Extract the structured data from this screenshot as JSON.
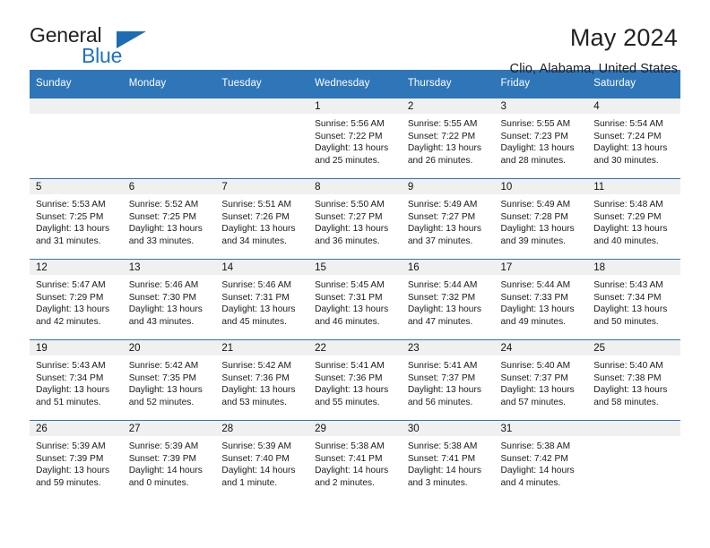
{
  "brand": {
    "name_top": "General",
    "name_bottom": "Blue",
    "triangle_color": "#1b6cb5",
    "blue_color": "#1e73be"
  },
  "header": {
    "title": "May 2024",
    "subtitle": "Clio, Alabama, United States"
  },
  "theme": {
    "header_blue": "#2f76b8",
    "daynum_band": "#f0f0f0",
    "text": "#1a1a1a"
  },
  "weekday_headers": [
    "Sunday",
    "Monday",
    "Tuesday",
    "Wednesday",
    "Thursday",
    "Friday",
    "Saturday"
  ],
  "labels": {
    "sunrise_prefix": "Sunrise:",
    "sunset_prefix": "Sunset:",
    "daylight_prefix": "Daylight:"
  },
  "weeks": [
    [
      {
        "day": "",
        "sunrise": "",
        "sunset": "",
        "daylight_line1": "",
        "daylight_line2": "",
        "empty": true
      },
      {
        "day": "",
        "sunrise": "",
        "sunset": "",
        "daylight_line1": "",
        "daylight_line2": "",
        "empty": true
      },
      {
        "day": "",
        "sunrise": "",
        "sunset": "",
        "daylight_line1": "",
        "daylight_line2": "",
        "empty": true
      },
      {
        "day": "1",
        "sunrise": "Sunrise: 5:56 AM",
        "sunset": "Sunset: 7:22 PM",
        "daylight_line1": "Daylight: 13 hours",
        "daylight_line2": "and 25 minutes."
      },
      {
        "day": "2",
        "sunrise": "Sunrise: 5:55 AM",
        "sunset": "Sunset: 7:22 PM",
        "daylight_line1": "Daylight: 13 hours",
        "daylight_line2": "and 26 minutes."
      },
      {
        "day": "3",
        "sunrise": "Sunrise: 5:55 AM",
        "sunset": "Sunset: 7:23 PM",
        "daylight_line1": "Daylight: 13 hours",
        "daylight_line2": "and 28 minutes."
      },
      {
        "day": "4",
        "sunrise": "Sunrise: 5:54 AM",
        "sunset": "Sunset: 7:24 PM",
        "daylight_line1": "Daylight: 13 hours",
        "daylight_line2": "and 30 minutes."
      }
    ],
    [
      {
        "day": "5",
        "sunrise": "Sunrise: 5:53 AM",
        "sunset": "Sunset: 7:25 PM",
        "daylight_line1": "Daylight: 13 hours",
        "daylight_line2": "and 31 minutes."
      },
      {
        "day": "6",
        "sunrise": "Sunrise: 5:52 AM",
        "sunset": "Sunset: 7:25 PM",
        "daylight_line1": "Daylight: 13 hours",
        "daylight_line2": "and 33 minutes."
      },
      {
        "day": "7",
        "sunrise": "Sunrise: 5:51 AM",
        "sunset": "Sunset: 7:26 PM",
        "daylight_line1": "Daylight: 13 hours",
        "daylight_line2": "and 34 minutes."
      },
      {
        "day": "8",
        "sunrise": "Sunrise: 5:50 AM",
        "sunset": "Sunset: 7:27 PM",
        "daylight_line1": "Daylight: 13 hours",
        "daylight_line2": "and 36 minutes."
      },
      {
        "day": "9",
        "sunrise": "Sunrise: 5:49 AM",
        "sunset": "Sunset: 7:27 PM",
        "daylight_line1": "Daylight: 13 hours",
        "daylight_line2": "and 37 minutes."
      },
      {
        "day": "10",
        "sunrise": "Sunrise: 5:49 AM",
        "sunset": "Sunset: 7:28 PM",
        "daylight_line1": "Daylight: 13 hours",
        "daylight_line2": "and 39 minutes."
      },
      {
        "day": "11",
        "sunrise": "Sunrise: 5:48 AM",
        "sunset": "Sunset: 7:29 PM",
        "daylight_line1": "Daylight: 13 hours",
        "daylight_line2": "and 40 minutes."
      }
    ],
    [
      {
        "day": "12",
        "sunrise": "Sunrise: 5:47 AM",
        "sunset": "Sunset: 7:29 PM",
        "daylight_line1": "Daylight: 13 hours",
        "daylight_line2": "and 42 minutes."
      },
      {
        "day": "13",
        "sunrise": "Sunrise: 5:46 AM",
        "sunset": "Sunset: 7:30 PM",
        "daylight_line1": "Daylight: 13 hours",
        "daylight_line2": "and 43 minutes."
      },
      {
        "day": "14",
        "sunrise": "Sunrise: 5:46 AM",
        "sunset": "Sunset: 7:31 PM",
        "daylight_line1": "Daylight: 13 hours",
        "daylight_line2": "and 45 minutes."
      },
      {
        "day": "15",
        "sunrise": "Sunrise: 5:45 AM",
        "sunset": "Sunset: 7:31 PM",
        "daylight_line1": "Daylight: 13 hours",
        "daylight_line2": "and 46 minutes."
      },
      {
        "day": "16",
        "sunrise": "Sunrise: 5:44 AM",
        "sunset": "Sunset: 7:32 PM",
        "daylight_line1": "Daylight: 13 hours",
        "daylight_line2": "and 47 minutes."
      },
      {
        "day": "17",
        "sunrise": "Sunrise: 5:44 AM",
        "sunset": "Sunset: 7:33 PM",
        "daylight_line1": "Daylight: 13 hours",
        "daylight_line2": "and 49 minutes."
      },
      {
        "day": "18",
        "sunrise": "Sunrise: 5:43 AM",
        "sunset": "Sunset: 7:34 PM",
        "daylight_line1": "Daylight: 13 hours",
        "daylight_line2": "and 50 minutes."
      }
    ],
    [
      {
        "day": "19",
        "sunrise": "Sunrise: 5:43 AM",
        "sunset": "Sunset: 7:34 PM",
        "daylight_line1": "Daylight: 13 hours",
        "daylight_line2": "and 51 minutes."
      },
      {
        "day": "20",
        "sunrise": "Sunrise: 5:42 AM",
        "sunset": "Sunset: 7:35 PM",
        "daylight_line1": "Daylight: 13 hours",
        "daylight_line2": "and 52 minutes."
      },
      {
        "day": "21",
        "sunrise": "Sunrise: 5:42 AM",
        "sunset": "Sunset: 7:36 PM",
        "daylight_line1": "Daylight: 13 hours",
        "daylight_line2": "and 53 minutes."
      },
      {
        "day": "22",
        "sunrise": "Sunrise: 5:41 AM",
        "sunset": "Sunset: 7:36 PM",
        "daylight_line1": "Daylight: 13 hours",
        "daylight_line2": "and 55 minutes."
      },
      {
        "day": "23",
        "sunrise": "Sunrise: 5:41 AM",
        "sunset": "Sunset: 7:37 PM",
        "daylight_line1": "Daylight: 13 hours",
        "daylight_line2": "and 56 minutes."
      },
      {
        "day": "24",
        "sunrise": "Sunrise: 5:40 AM",
        "sunset": "Sunset: 7:37 PM",
        "daylight_line1": "Daylight: 13 hours",
        "daylight_line2": "and 57 minutes."
      },
      {
        "day": "25",
        "sunrise": "Sunrise: 5:40 AM",
        "sunset": "Sunset: 7:38 PM",
        "daylight_line1": "Daylight: 13 hours",
        "daylight_line2": "and 58 minutes."
      }
    ],
    [
      {
        "day": "26",
        "sunrise": "Sunrise: 5:39 AM",
        "sunset": "Sunset: 7:39 PM",
        "daylight_line1": "Daylight: 13 hours",
        "daylight_line2": "and 59 minutes."
      },
      {
        "day": "27",
        "sunrise": "Sunrise: 5:39 AM",
        "sunset": "Sunset: 7:39 PM",
        "daylight_line1": "Daylight: 14 hours",
        "daylight_line2": "and 0 minutes."
      },
      {
        "day": "28",
        "sunrise": "Sunrise: 5:39 AM",
        "sunset": "Sunset: 7:40 PM",
        "daylight_line1": "Daylight: 14 hours",
        "daylight_line2": "and 1 minute."
      },
      {
        "day": "29",
        "sunrise": "Sunrise: 5:38 AM",
        "sunset": "Sunset: 7:41 PM",
        "daylight_line1": "Daylight: 14 hours",
        "daylight_line2": "and 2 minutes."
      },
      {
        "day": "30",
        "sunrise": "Sunrise: 5:38 AM",
        "sunset": "Sunset: 7:41 PM",
        "daylight_line1": "Daylight: 14 hours",
        "daylight_line2": "and 3 minutes."
      },
      {
        "day": "31",
        "sunrise": "Sunrise: 5:38 AM",
        "sunset": "Sunset: 7:42 PM",
        "daylight_line1": "Daylight: 14 hours",
        "daylight_line2": "and 4 minutes."
      },
      {
        "day": "",
        "sunrise": "",
        "sunset": "",
        "daylight_line1": "",
        "daylight_line2": "",
        "empty": true
      }
    ]
  ]
}
